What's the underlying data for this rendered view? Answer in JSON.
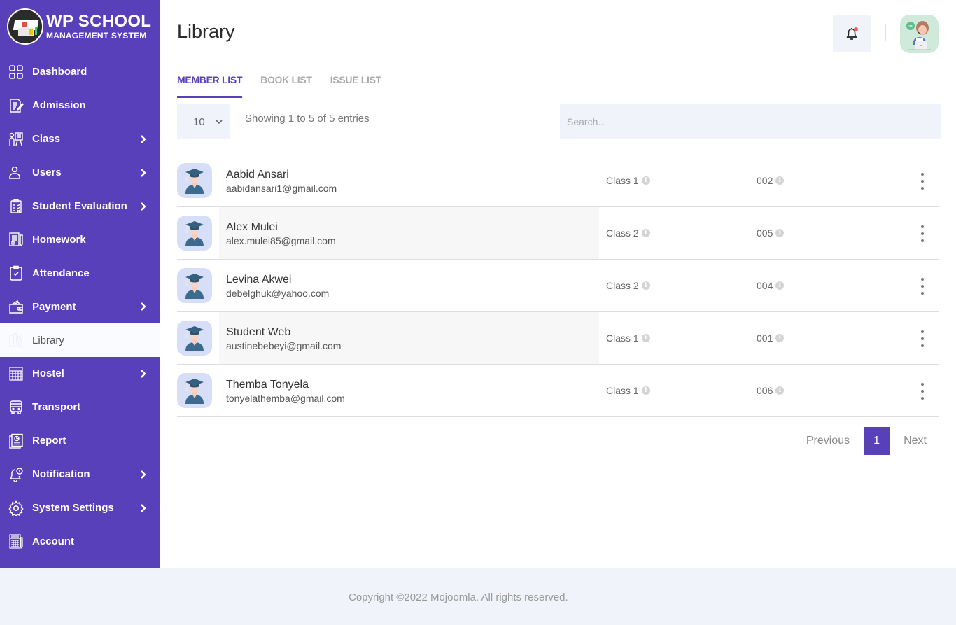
{
  "brand": {
    "title": "WP SCHOOL",
    "subtitle": "MANAGEMENT SYSTEM"
  },
  "sidebar": {
    "items": [
      {
        "label": "Dashboard",
        "icon": "dashboard-icon",
        "has_submenu": false,
        "active": false
      },
      {
        "label": "Admission",
        "icon": "admission-icon",
        "has_submenu": false,
        "active": false
      },
      {
        "label": "Class",
        "icon": "class-icon",
        "has_submenu": true,
        "active": false
      },
      {
        "label": "Users",
        "icon": "user-icon",
        "has_submenu": true,
        "active": false
      },
      {
        "label": "Student Evaluation",
        "icon": "clipboard-icon",
        "has_submenu": true,
        "active": false
      },
      {
        "label": "Homework",
        "icon": "homework-icon",
        "has_submenu": false,
        "active": false
      },
      {
        "label": "Attendance",
        "icon": "attendance-icon",
        "has_submenu": false,
        "active": false
      },
      {
        "label": "Payment",
        "icon": "wallet-icon",
        "has_submenu": true,
        "active": false
      },
      {
        "label": "Library",
        "icon": "library-icon",
        "has_submenu": false,
        "active": true
      },
      {
        "label": "Hostel",
        "icon": "hostel-icon",
        "has_submenu": true,
        "active": false
      },
      {
        "label": "Transport",
        "icon": "bus-icon",
        "has_submenu": false,
        "active": false
      },
      {
        "label": "Report",
        "icon": "report-icon",
        "has_submenu": false,
        "active": false
      },
      {
        "label": "Notification",
        "icon": "notification-icon",
        "has_submenu": true,
        "active": false
      },
      {
        "label": "System Settings",
        "icon": "gear-icon",
        "has_submenu": true,
        "active": false
      },
      {
        "label": "Account",
        "icon": "account-icon",
        "has_submenu": false,
        "active": false
      }
    ]
  },
  "header": {
    "title": "Library",
    "notification_badge": true
  },
  "tabs": [
    {
      "label": "MEMBER LIST",
      "active": true
    },
    {
      "label": "BOOK LIST",
      "active": false
    },
    {
      "label": "ISSUE LIST",
      "active": false
    }
  ],
  "controls": {
    "page_size": "10",
    "showing": "Showing 1 to 5 of 5 entries",
    "search_placeholder": "Search...",
    "search_value": ""
  },
  "members": [
    {
      "name": "Aabid Ansari",
      "email": "aabidansari1@gmail.com",
      "class": "Class 1",
      "roll": "002"
    },
    {
      "name": "Alex Mulei",
      "email": "alex.mulei85@gmail.com",
      "class": "Class 2",
      "roll": "005"
    },
    {
      "name": "Levina Akwei",
      "email": "debelghuk@yahoo.com",
      "class": "Class 2",
      "roll": "004"
    },
    {
      "name": "Student Web",
      "email": "austinebebeyi@gmail.com",
      "class": "Class 1",
      "roll": "001"
    },
    {
      "name": "Themba Tonyela",
      "email": "tonyelathemba@gmail.com",
      "class": "Class 1",
      "roll": "006"
    }
  ],
  "pagination": {
    "previous": "Previous",
    "current": "1",
    "next": "Next"
  },
  "footer": {
    "text": "Copyright ©2022 Mojoomla. All rights reserved."
  },
  "colors": {
    "brand": "#5840bb",
    "panel": "#f0f3f9"
  }
}
